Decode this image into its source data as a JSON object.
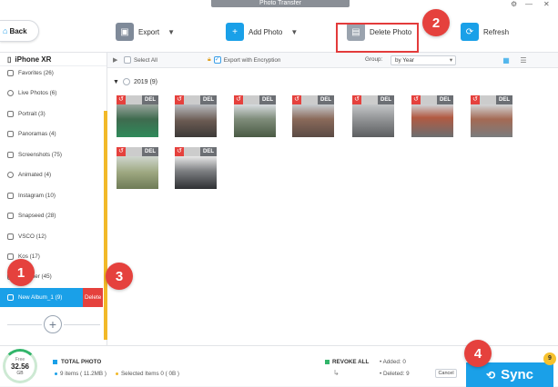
{
  "app": {
    "title": "Photo Transfer",
    "window_controls": [
      "gear-icon",
      "minimize-icon",
      "close-icon"
    ]
  },
  "toolbar": {
    "back_label": "Back",
    "export_label": "Export",
    "add_photo_label": "Add Photo",
    "delete_photo_label": "Delete Photo",
    "refresh_label": "Refresh"
  },
  "markers": [
    "1",
    "2",
    "3",
    "4"
  ],
  "sidebar": {
    "device": "iPhone XR",
    "items": [
      {
        "label": "Favorites (26)",
        "icon": "heart-icon"
      },
      {
        "label": "Live Photos (6)",
        "icon": "live-photo-icon"
      },
      {
        "label": "Portrait (3)",
        "icon": "cube-icon"
      },
      {
        "label": "Panoramas (4)",
        "icon": "panorama-icon"
      },
      {
        "label": "Screenshots (75)",
        "icon": "screenshot-icon"
      },
      {
        "label": "Animated (4)",
        "icon": "animated-icon"
      },
      {
        "label": "Instagram (10)",
        "icon": "album-icon"
      },
      {
        "label": "Snapseed (28)",
        "icon": "album-icon"
      },
      {
        "label": "VSCO (12)",
        "icon": "album-icon"
      },
      {
        "label": "Kos (17)",
        "icon": "album-icon"
      },
      {
        "label": "Summer (45)",
        "icon": "album-icon"
      },
      {
        "label": "New Album_1 (9)",
        "icon": "album-icon",
        "active": true
      }
    ],
    "delete_label": "Delete"
  },
  "filterbar": {
    "select_all": "Select All",
    "export_encryption": "Export with Encryption",
    "group_label": "Group:",
    "group_value": "by Year"
  },
  "content": {
    "year_label": "2019 (9)",
    "del_tag": "DEL",
    "undo_icon": "undo-icon"
  },
  "bottom": {
    "storage_free_label": "Free",
    "storage_value": "32.56",
    "storage_unit": "GB",
    "total_photo_label": "TOTAL PHOTO",
    "items_text": "9 items ( 11.2MB )",
    "selected_text": "Selected Items 0 ( 0B )",
    "revoke_all": "REVOKE ALL",
    "added_text": "Added: 0",
    "deleted_text": "Deleted: 9",
    "cancel_label": "Cancel",
    "sync_label": "Sync",
    "sync_badge": "9"
  },
  "colors": {
    "accent": "#1aa0e8",
    "marker_red": "#e5413d",
    "highlight_yellow": "#f2b928"
  }
}
